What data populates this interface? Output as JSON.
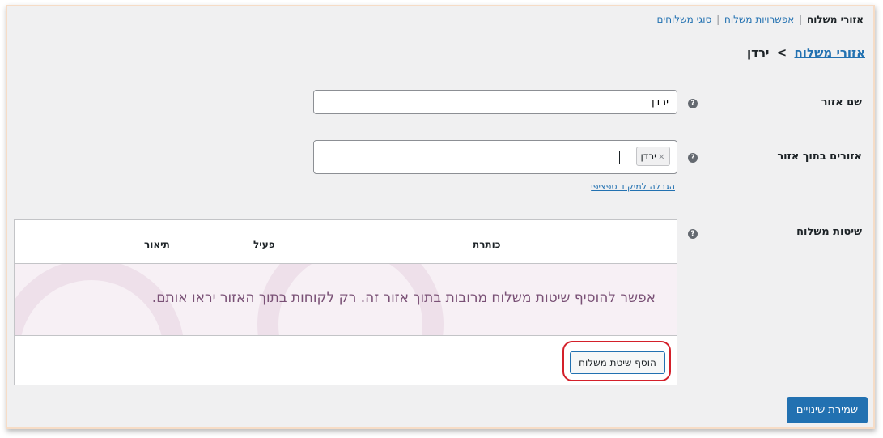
{
  "subnav": {
    "current": "אזורי משלוח",
    "options_link": "אפשרויות משלוח",
    "classes_link": "סוגי משלוחים",
    "separator": "|"
  },
  "title": {
    "breadcrumb_link": "אזורי משלוח",
    "separator": ">",
    "zone_name": "ירדן"
  },
  "fields": {
    "zone_name_label": "שם אזור",
    "zone_name_value": "ירדן",
    "zone_regions_label": "אזורים בתוך אזור",
    "region_chip": "ירדן",
    "chip_remove": "×",
    "limit_link": "הגבלה למיקוד ספציפי",
    "help_glyph": "?"
  },
  "methods": {
    "label": "שיטות משלוח",
    "columns": [
      "כותרת",
      "פעיל",
      "תיאור"
    ],
    "blank_message": "אפשר להוסיף שיטות משלוח מרובות בתוך אזור זה. רק לקוחות בתוך האזור יראו אותם.",
    "add_button": "הוסף שיטת משלוח"
  },
  "save_button": "שמירת שינויים",
  "icons": {
    "help": "help-icon",
    "remove": "close-icon"
  },
  "colors": {
    "link": "#2271b1",
    "primary_button": "#2271b1",
    "highlight_ring": "#d4202a",
    "blank_state_bg": "#f7f0f5"
  }
}
